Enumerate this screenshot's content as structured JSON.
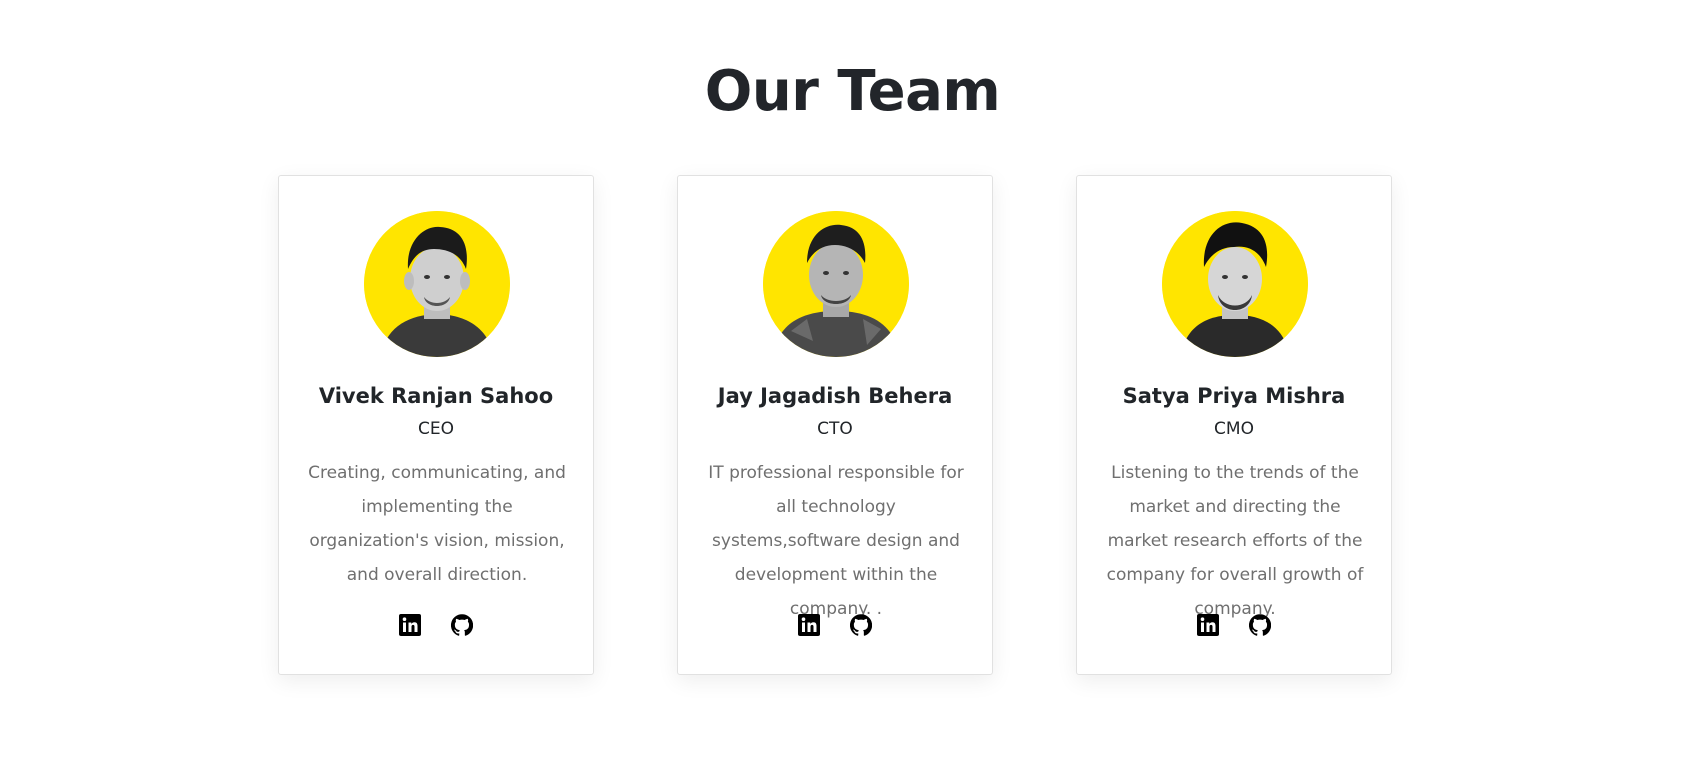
{
  "section": {
    "title": "Our Team"
  },
  "members": [
    {
      "name": "Vivek Ranjan Sahoo",
      "role": "CEO",
      "bio": "Creating, communicating, and implementing the organization's vision, mission, and overall direction.",
      "avatar_bg": "#ffe500"
    },
    {
      "name": "Jay Jagadish Behera",
      "role": "CTO",
      "bio": "IT professional responsible for all technology systems,software design and development within the company. .",
      "avatar_bg": "#ffe500"
    },
    {
      "name": "Satya Priya Mishra",
      "role": "CMO",
      "bio": "Listening to the trends of the market and directing the market research efforts of the company for overall growth of company.",
      "avatar_bg": "#ffe500"
    }
  ],
  "social_icons": [
    "linkedin-icon",
    "github-icon"
  ],
  "colors": {
    "accent_yellow": "#ffe500",
    "heading": "#22252a",
    "body_text": "#6f6f6f",
    "card_border": "#e1e1e1"
  }
}
